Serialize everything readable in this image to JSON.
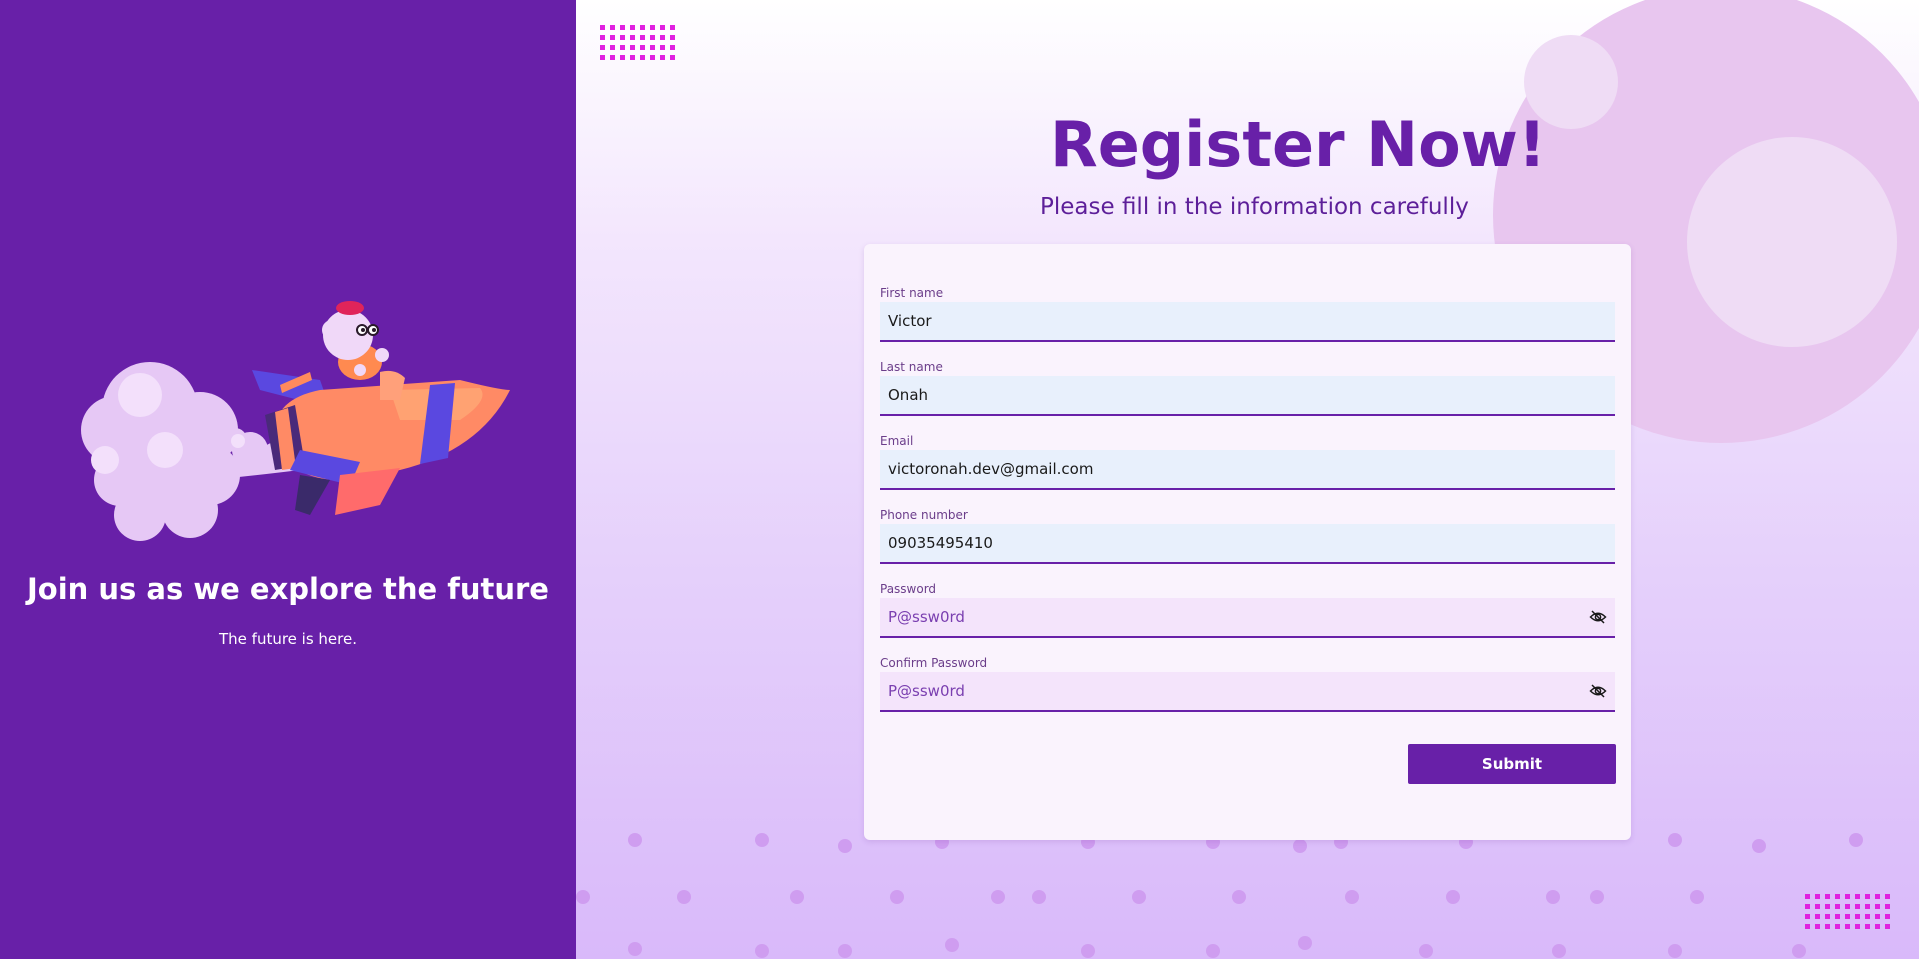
{
  "left": {
    "heading": "Join us as we explore the future",
    "subheading": "The future is here.",
    "illustration_icon": "rocket-illustration"
  },
  "header": {
    "title": "Register Now!",
    "subtitle": "Please fill in the information carefully"
  },
  "form": {
    "fields": [
      {
        "label": "First name",
        "value": "Victor"
      },
      {
        "label": "Last name",
        "value": "Onah"
      },
      {
        "label": "Email",
        "value": "victoronah.dev@gmail.com"
      },
      {
        "label": "Phone number",
        "value": "09035495410"
      },
      {
        "label": "Password",
        "value": "P@ssw0rd",
        "icon": "eye-slash-icon"
      },
      {
        "label": "Confirm Password",
        "value": "P@ssw0rd",
        "icon": "eye-slash-icon"
      }
    ],
    "submit_label": "Submit"
  },
  "colors": {
    "primary": "#6820a8",
    "accent_magenta": "#e020e0",
    "input_bg": "#e8f0fc",
    "password_bg": "#f4e4fb"
  }
}
